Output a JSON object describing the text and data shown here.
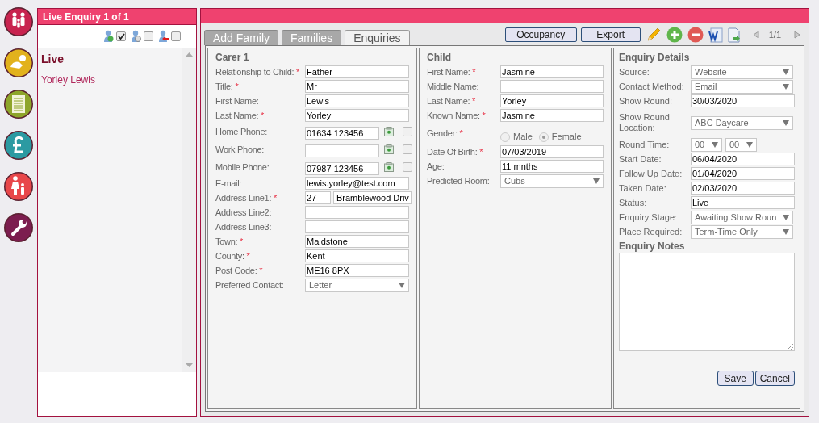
{
  "sidebar_list": {
    "title": "Live Enquiry 1 of 1",
    "filters": [
      {
        "checked": true
      },
      {
        "checked": false
      },
      {
        "checked": false
      }
    ],
    "group": "Live",
    "items": [
      "Yorley Lewis"
    ]
  },
  "tabs": [
    {
      "label": "Add Family",
      "selected": false
    },
    {
      "label": "Families",
      "selected": false
    },
    {
      "label": "Enquiries",
      "selected": true
    }
  ],
  "toolbar": {
    "buttons": [
      "Occupancy",
      "Export"
    ],
    "pager": "1/1"
  },
  "required_mark": "*",
  "carer": {
    "title": "Carer 1",
    "fields": [
      {
        "kind": "text",
        "label": "Relationship to Child:",
        "required": true,
        "value": "Father"
      },
      {
        "kind": "text",
        "label": "Title:",
        "required": true,
        "value": "Mr"
      },
      {
        "kind": "text",
        "label": "First Name:",
        "required": false,
        "value": "Lewis"
      },
      {
        "kind": "text",
        "label": "Last Name:",
        "required": true,
        "value": "Yorley"
      },
      {
        "kind": "phone",
        "label": "Home Phone:",
        "required": false,
        "value": "01634 123456",
        "checked": false
      },
      {
        "kind": "phone",
        "label": "Work Phone:",
        "required": false,
        "checked": false
      },
      {
        "kind": "phone",
        "label": "Mobile Phone:",
        "required": false,
        "value": "07987 123456",
        "checked": false
      },
      {
        "kind": "text",
        "label": "E-mail:",
        "required": false,
        "value": "lewis.yorley@test.com"
      },
      {
        "kind": "address",
        "label": "Address Line1:",
        "required": true,
        "values": [
          "27",
          "Bramblewood Driv"
        ]
      },
      {
        "kind": "text",
        "label": "Address Line2:",
        "required": false
      },
      {
        "kind": "text",
        "label": "Address Line3:",
        "required": false
      },
      {
        "kind": "text",
        "label": "Town:",
        "required": true,
        "value": "Maidstone"
      },
      {
        "kind": "text",
        "label": "County:",
        "required": true,
        "value": "Kent"
      },
      {
        "kind": "text",
        "label": "Post Code:",
        "required": true,
        "value": "ME16 8PX"
      },
      {
        "kind": "select",
        "label": "Preferred Contact:",
        "required": false,
        "value": "Letter"
      }
    ]
  },
  "child": {
    "title": "Child",
    "fields": [
      {
        "kind": "text",
        "label": "First Name:",
        "required": true,
        "value": "Jasmine"
      },
      {
        "kind": "text",
        "label": "Middle Name:",
        "required": false
      },
      {
        "kind": "text",
        "label": "Last Name:",
        "required": true,
        "value": "Yorley"
      },
      {
        "kind": "text",
        "label": "Known Name:",
        "required": true,
        "value": "Jasmine"
      },
      {
        "kind": "radio",
        "label": "Gender:",
        "required": true,
        "options": [
          {
            "label": "Male",
            "selected": false
          },
          {
            "label": "Female",
            "selected": true
          }
        ]
      },
      {
        "kind": "text",
        "label": "Date Of Birth:",
        "required": true,
        "value": "07/03/2019"
      },
      {
        "kind": "text",
        "label": "Age:",
        "required": false,
        "value": "11 mnths"
      },
      {
        "kind": "select",
        "label": "Predicted Room:",
        "required": false,
        "value": "Cubs"
      }
    ]
  },
  "enquiry": {
    "title": "Enquiry Details",
    "fields": [
      {
        "kind": "select",
        "label": "Source:",
        "required": false,
        "value": "Website"
      },
      {
        "kind": "select",
        "label": "Contact Method:",
        "required": false,
        "value": "Email"
      },
      {
        "kind": "text",
        "label": "Show Round:",
        "required": false,
        "value": "30/03/2020"
      },
      {
        "kind": "select",
        "label": "Show Round Location:",
        "required": false,
        "value": "ABC Daycare"
      },
      {
        "kind": "time",
        "label": "Round Time:",
        "required": false,
        "values": [
          "00",
          "00"
        ]
      },
      {
        "kind": "text",
        "label": "Start Date:",
        "required": false,
        "value": "06/04/2020"
      },
      {
        "kind": "text",
        "label": "Follow Up Date:",
        "required": false,
        "value": "01/04/2020"
      },
      {
        "kind": "text",
        "label": "Taken Date:",
        "required": false,
        "value": "02/03/2020"
      },
      {
        "kind": "text",
        "label": "Status:",
        "required": false,
        "value": "Live"
      },
      {
        "kind": "select",
        "label": "Enquiry Stage:",
        "required": false,
        "value": "Awaiting Show Roun"
      },
      {
        "kind": "select",
        "label": "Place Required:",
        "required": false,
        "value": "Term-Time Only"
      }
    ],
    "notes_title": "Enquiry Notes",
    "buttons": [
      "Save",
      "Cancel"
    ]
  }
}
